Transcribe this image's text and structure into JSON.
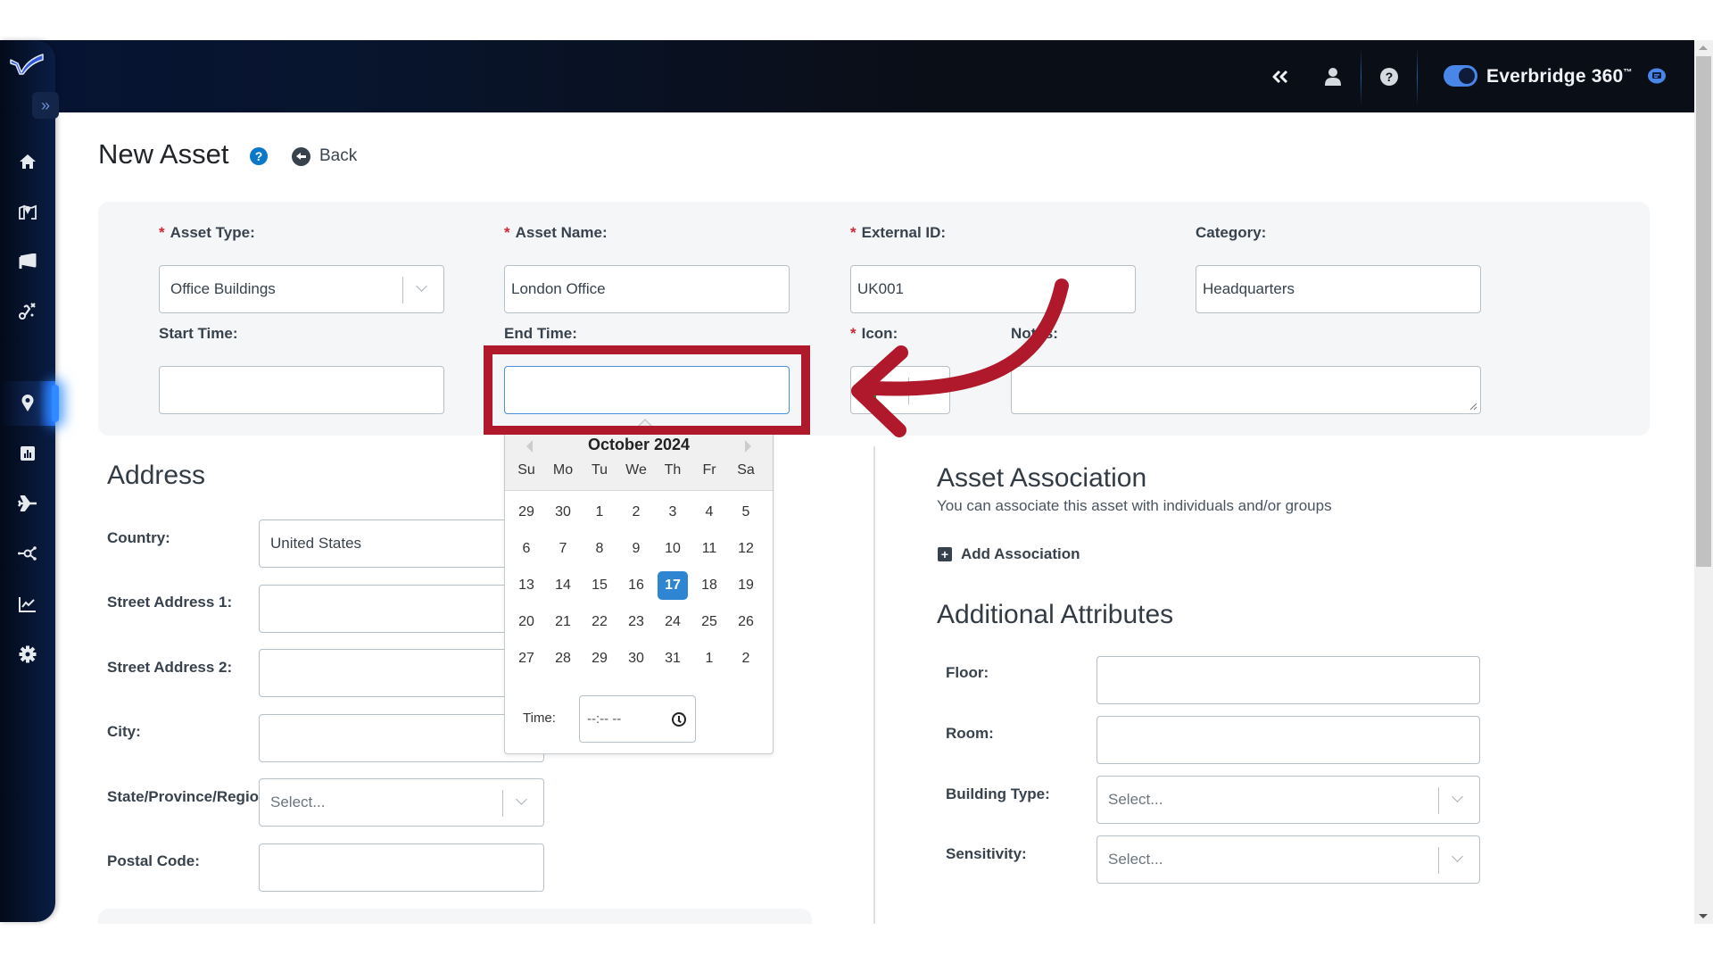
{
  "header": {
    "collapse_icon": "double-chevron-left-icon",
    "user_icon": "user-icon",
    "help_icon": "question-circle-icon",
    "toggle_on": true,
    "brand": "Everbridge 360",
    "brand_tm": "™",
    "chat_icon": "chat-bubble-icon"
  },
  "sidebar": {
    "logo": "everbridge-logo",
    "expand_label": "»",
    "active_item": "assets",
    "items": [
      {
        "id": "home",
        "icon": "home-icon"
      },
      {
        "id": "map",
        "icon": "map-icon"
      },
      {
        "id": "communications",
        "icon": "megaphone-icon"
      },
      {
        "id": "travel-routes",
        "icon": "route-icon"
      },
      {
        "id": "assets",
        "icon": "location-pin-icon"
      },
      {
        "id": "reports",
        "icon": "bar-chart-icon"
      },
      {
        "id": "travel",
        "icon": "airplane-icon"
      },
      {
        "id": "integrations",
        "icon": "network-icon"
      },
      {
        "id": "analytics",
        "icon": "line-chart-icon"
      },
      {
        "id": "settings",
        "icon": "gear-icon"
      }
    ]
  },
  "page": {
    "title": "New Asset",
    "help_label": "?",
    "back_label": "Back"
  },
  "form": {
    "asset_type": {
      "label": "Asset Type:",
      "required": "*",
      "value": "Office Buildings"
    },
    "asset_name": {
      "label": "Asset Name:",
      "required": "*",
      "value": "London Office"
    },
    "external_id": {
      "label": "External ID:",
      "required": "*",
      "value": "UK001"
    },
    "category": {
      "label": "Category:",
      "value": "Headquarters"
    },
    "start_time": {
      "label": "Start Time:",
      "value": ""
    },
    "end_time": {
      "label": "End Time:",
      "value": ""
    },
    "icon": {
      "label": "Icon:",
      "required": "*",
      "value": "green-marker"
    },
    "notes": {
      "label": "Notes:",
      "value": ""
    }
  },
  "calendar": {
    "month_label": "October 2024",
    "weekdays": [
      "Su",
      "Mo",
      "Tu",
      "We",
      "Th",
      "Fr",
      "Sa"
    ],
    "weeks": [
      [
        "29",
        "30",
        "1",
        "2",
        "3",
        "4",
        "5"
      ],
      [
        "6",
        "7",
        "8",
        "9",
        "10",
        "11",
        "12"
      ],
      [
        "13",
        "14",
        "15",
        "16",
        "17",
        "18",
        "19"
      ],
      [
        "20",
        "21",
        "22",
        "23",
        "24",
        "25",
        "26"
      ],
      [
        "27",
        "28",
        "29",
        "30",
        "31",
        "1",
        "2"
      ]
    ],
    "selected_day": "17",
    "time_label": "Time:",
    "time_value": "--:-- --"
  },
  "address": {
    "title": "Address",
    "fields": [
      {
        "label": "Country:",
        "value": "United States",
        "type": "text"
      },
      {
        "label": "Street Address 1:",
        "value": "",
        "type": "text"
      },
      {
        "label": "Street Address 2:",
        "value": "",
        "type": "text"
      },
      {
        "label": "City:",
        "value": "",
        "type": "text"
      },
      {
        "label": "State/Province/Regio",
        "value": "Select...",
        "type": "select"
      },
      {
        "label": "Postal Code:",
        "value": "",
        "type": "text"
      }
    ]
  },
  "association": {
    "title": "Asset Association",
    "subtitle": "You can associate this asset with individuals and/or groups",
    "add_label": "Add Association",
    "add_icon": "+"
  },
  "attributes": {
    "title": "Additional Attributes",
    "fields": [
      {
        "label": "Floor:",
        "value": "",
        "type": "text"
      },
      {
        "label": "Room:",
        "value": "",
        "type": "text"
      },
      {
        "label": "Building Type:",
        "value": "Select...",
        "type": "select"
      },
      {
        "label": "Sensitivity:",
        "value": "Select...",
        "type": "select"
      }
    ]
  },
  "annotation": {
    "highlight_color": "#b0182b",
    "target": "end-time-input"
  }
}
